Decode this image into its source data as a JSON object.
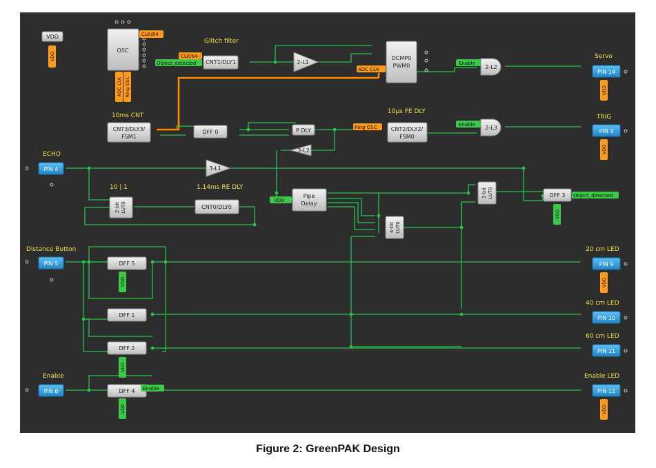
{
  "caption": "Figure 2: GreenPAK Design",
  "colors": {
    "background": "#2d2d2d",
    "wire_green": "#27c44a",
    "wire_orange": "#ff8a00",
    "pin_blue": "#2f9bdc",
    "block_gray": "#dadada",
    "label_yellow": "#f3e04a",
    "tag_green": "#3ec84a",
    "tag_orange": "#ff9a1a"
  },
  "titles": {
    "glitch_filter": "Glitch filter",
    "cnt10ms": "10ms CNT",
    "fe_dly": "10µs FE DLY",
    "lut_10_1": "10 | 1",
    "re_dly": "1.14ms RE DLY",
    "echo": "ECHO",
    "distance_button": "Distance Button",
    "enable": "Enable",
    "servo": "Servo",
    "trig": "TRIG",
    "led20": "20 cm LED",
    "led40": "40 cm LED",
    "led60": "60 cm LED",
    "enable_led": "Enable LED"
  },
  "blocks": {
    "vdd": "VDD",
    "osc": "OSC",
    "cnt1": "CNT1/DLY1",
    "dcmp_1": "DCMP0",
    "dcmp_2": "PWM0",
    "l2_2": "2-L2",
    "l1_2": "2-L1",
    "cnt3_1": "CNT3/DLY3/",
    "cnt3_2": "FSM1",
    "dff0": "DFF 0",
    "pdly": "P DLY",
    "l3_2": "3-L2",
    "cnt2_1": "CNT2/DLY2/",
    "cnt2_2": "FSM0",
    "l3_2b": "2-L3",
    "l3_1": "3-L1",
    "lut2_1": "2-bit",
    "lut2_2": "LUT0",
    "cnt0": "CNT0/DLY0",
    "pipe_1": "Pipe",
    "pipe_2": "Delay",
    "lut4_1": "4-bit",
    "lut4_2": "LUT0",
    "lut3_1": "3-bit",
    "lut3_2": "LUT0",
    "dff3": "DFF 3",
    "dff5": "DFF 5",
    "dff1": "DFF 1",
    "dff2": "DFF 2",
    "dff4": "DFF 4"
  },
  "pins": {
    "pin4": "PIN 4",
    "pin5": "PIN 5",
    "pin6": "PIN 6",
    "pin14": "PIN 14",
    "pin3": "PIN 3",
    "pin9": "PIN 9",
    "pin10": "PIN 10",
    "pin11": "PIN 11",
    "pin12": "PIN 12"
  },
  "tags": {
    "clk64_out": "CLK/64",
    "clk64_in": "CLK/64",
    "object_detected_in": "Object_detected",
    "adc_clk_in": "ADC CLK",
    "enable_2l2": "Enable",
    "ring_osc": "Ring OSC",
    "enable_2l3": "Enable",
    "vdd_pipe": "VDD",
    "object_detected_out": "Object_detected",
    "enable_out": "Enable",
    "osc_adc_clk": "ADC CLK",
    "osc_ring_osc": "Ring OSC",
    "vdd_power": "VDD",
    "vdd_pin14": "VDD",
    "vdd_pin3": "VDD",
    "vdd_dff3": "VDD",
    "vdd_dff5": "VDD",
    "vdd_pin9": "VDD",
    "vdd_dff2": "VDD",
    "vdd_dff4": "VDD",
    "vdd_pin12": "VDD"
  }
}
